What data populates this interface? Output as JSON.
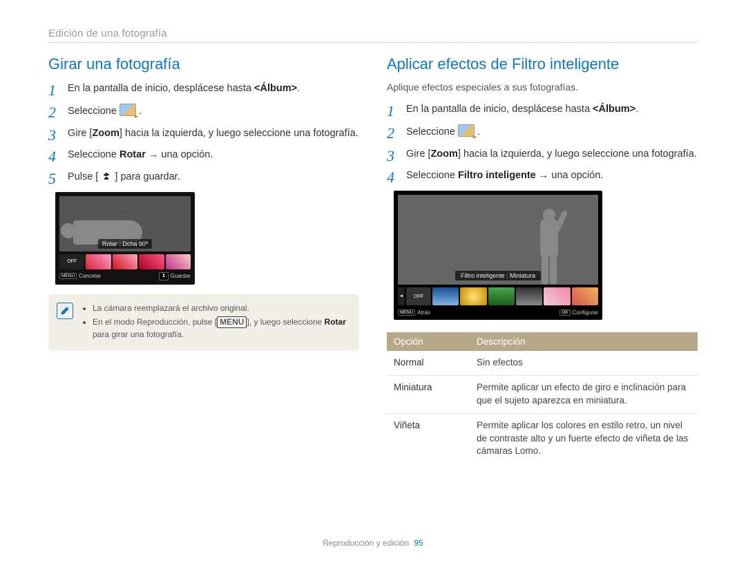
{
  "breadcrumb": "Edición de una fotografía",
  "left": {
    "title": "Girar una fotografía",
    "steps": {
      "s1_pre": "En la pantalla de inicio, desplácese hasta ",
      "s1_bold": "<Álbum>",
      "s1_post": ".",
      "s2_pre": "Seleccione ",
      "s2_post": ".",
      "s3_pre": "Gire [",
      "s3_bold": "Zoom",
      "s3_post": "] hacia la izquierda, y luego seleccione una fotografía.",
      "s4_pre": "Seleccione ",
      "s4_bold": "Rotar",
      "s4_post": " → una opción.",
      "s5_pre": "Pulse [",
      "s5_post": "] para guardar."
    },
    "lcd": {
      "label": "Rotar : Dcha 90º",
      "off": "OFF",
      "menu_key": "MENU",
      "cancel": "Cancelar",
      "save": "Guardar"
    },
    "note": {
      "b1": "La cámara reemplazará el archivo original.",
      "b2_pre": "En el modo Reproducción, pulse [",
      "b2_key": "MENU",
      "b2_mid": "], y luego seleccione ",
      "b2_bold": "Rotar",
      "b2_post": " para girar una fotografía."
    }
  },
  "right": {
    "title": "Aplicar efectos de Filtro inteligente",
    "intro": "Aplique efectos especiales a sus fotografías.",
    "steps": {
      "s1_pre": "En la pantalla de inicio, desplácese hasta ",
      "s1_bold": "<Álbum>",
      "s1_post": ".",
      "s2_pre": "Seleccione ",
      "s2_post": ".",
      "s3_pre": "Gire [",
      "s3_bold": "Zoom",
      "s3_post": "] hacia la izquierda, y luego seleccione una fotografía.",
      "s4_pre": "Seleccione ",
      "s4_bold": "Filtro inteligente",
      "s4_post": " → una opción."
    },
    "lcd": {
      "label": "Filtro inteligente : Miniatura",
      "off_tab": "◄",
      "off": "OFF",
      "menu_key": "MENU",
      "back": "Atrás",
      "ok_key": "OK",
      "config": "Configurar"
    },
    "table": {
      "h1": "Opción",
      "h2": "Descripción",
      "r1_opt": "Normal",
      "r1_desc": "Sin efectos",
      "r2_opt": "Miniatura",
      "r2_desc": "Permite aplicar un efecto de giro e inclinación para que el sujeto aparezca en miniatura.",
      "r3_opt": "Viñeta",
      "r3_desc": "Permite aplicar los colores en estilo retro, un nivel de contraste alto y un fuerte efecto de viñeta de las cámaras Lomo."
    }
  },
  "footer": {
    "section": "Reproducción y edición",
    "page": "95"
  }
}
